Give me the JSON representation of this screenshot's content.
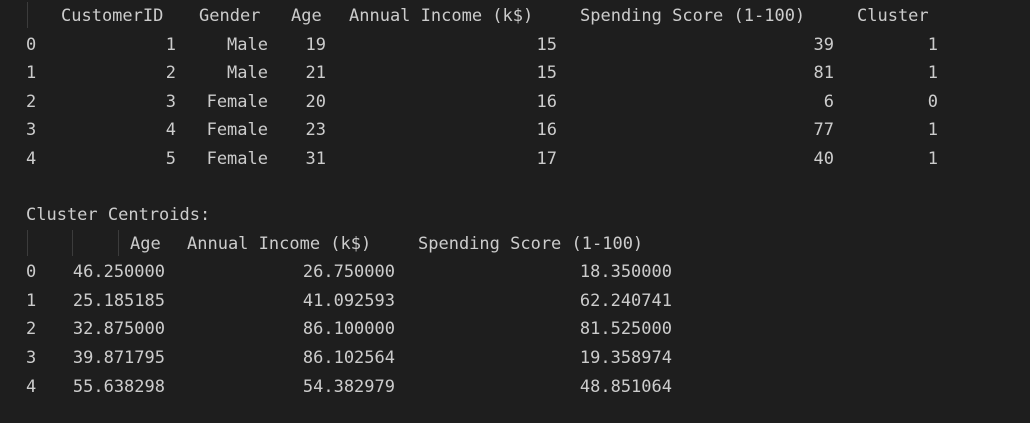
{
  "df_head": {
    "columns": [
      "CustomerID",
      "Gender",
      "Age",
      "Annual Income (k$)",
      "Spending Score (1-100)",
      "Cluster"
    ],
    "rows": [
      {
        "index": "0",
        "cells": [
          "1",
          "Male",
          "19",
          "15",
          "39",
          "1"
        ]
      },
      {
        "index": "1",
        "cells": [
          "2",
          "Male",
          "21",
          "15",
          "81",
          "1"
        ]
      },
      {
        "index": "2",
        "cells": [
          "3",
          "Female",
          "20",
          "16",
          "6",
          "0"
        ]
      },
      {
        "index": "3",
        "cells": [
          "4",
          "Female",
          "23",
          "16",
          "77",
          "1"
        ]
      },
      {
        "index": "4",
        "cells": [
          "5",
          "Female",
          "31",
          "17",
          "40",
          "1"
        ]
      }
    ]
  },
  "centroids": {
    "title": "Cluster Centroids:",
    "columns": [
      "Age",
      "Annual Income (k$)",
      "Spending Score (1-100)"
    ],
    "rows": [
      {
        "index": "0",
        "cells": [
          "46.250000",
          "26.750000",
          "18.350000"
        ]
      },
      {
        "index": "1",
        "cells": [
          "25.185185",
          "41.092593",
          "62.240741"
        ]
      },
      {
        "index": "2",
        "cells": [
          "32.875000",
          "86.100000",
          "81.525000"
        ]
      },
      {
        "index": "3",
        "cells": [
          "39.871795",
          "86.102564",
          "19.358974"
        ]
      },
      {
        "index": "4",
        "cells": [
          "55.638298",
          "54.382979",
          "48.851064"
        ]
      }
    ]
  }
}
